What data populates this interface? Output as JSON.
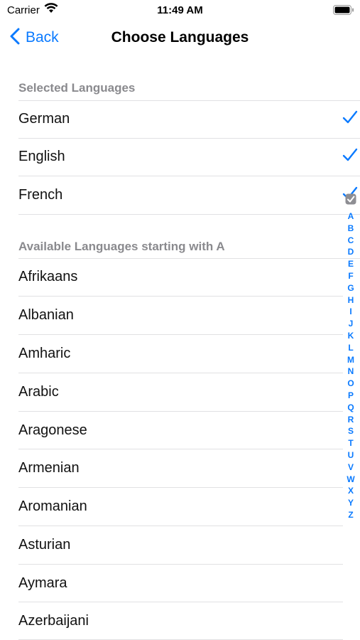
{
  "status_bar": {
    "carrier": "Carrier",
    "time": "11:49 AM"
  },
  "nav": {
    "back_label": "Back",
    "title": "Choose Languages"
  },
  "selected_section": {
    "header": "Selected Languages",
    "items": [
      {
        "label": "German",
        "checked": true
      },
      {
        "label": "English",
        "checked": true
      },
      {
        "label": "French",
        "checked": true
      }
    ]
  },
  "available_section": {
    "header": "Available Languages starting with A",
    "items": [
      {
        "label": "Afrikaans"
      },
      {
        "label": "Albanian"
      },
      {
        "label": "Amharic"
      },
      {
        "label": "Arabic"
      },
      {
        "label": "Aragonese"
      },
      {
        "label": "Armenian"
      },
      {
        "label": "Aromanian"
      },
      {
        "label": "Asturian"
      },
      {
        "label": "Aymara"
      },
      {
        "label": "Azerbaijani"
      }
    ]
  },
  "section_index": {
    "letters": [
      "A",
      "B",
      "C",
      "D",
      "E",
      "F",
      "G",
      "H",
      "I",
      "J",
      "K",
      "L",
      "M",
      "N",
      "O",
      "P",
      "Q",
      "R",
      "S",
      "T",
      "U",
      "V",
      "W",
      "X",
      "Y",
      "Z"
    ]
  },
  "colors": {
    "accent": "#0a7aff",
    "header_text": "#8a8a8e",
    "separator": "#e1e1e3"
  }
}
